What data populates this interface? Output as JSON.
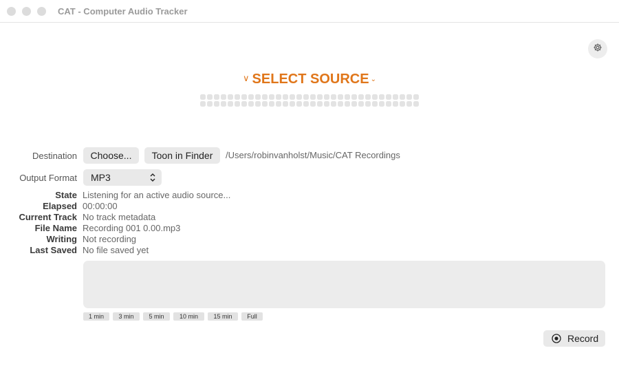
{
  "window": {
    "title": "CAT - Computer Audio Tracker"
  },
  "source": {
    "label": "SELECT SOURCE",
    "accent_color": "#e0761a"
  },
  "destination": {
    "label": "Destination",
    "choose_button": "Choose...",
    "finder_button": "Toon in Finder",
    "path": "/Users/robinvanholst/Music/CAT Recordings"
  },
  "output_format": {
    "label": "Output Format",
    "selected": "MP3"
  },
  "status": {
    "state_label": "State",
    "state_value": "Listening for an active audio source...",
    "elapsed_label": "Elapsed",
    "elapsed_value": "00:00:00",
    "track_label": "Current Track",
    "track_value": "No track metadata",
    "filename_label": "File Name",
    "filename_value": "Recording 001 0.00.mp3",
    "writing_label": "Writing",
    "writing_value": "Not recording",
    "saved_label": "Last Saved",
    "saved_value": "No file saved yet"
  },
  "time_ranges": [
    "1 min",
    "3 min",
    "5 min",
    "10 min",
    "15 min",
    "Full"
  ],
  "record": {
    "label": "Record"
  },
  "icons": {
    "settings": "gear-icon",
    "record": "record-icon",
    "chevron": "chevron-down-icon",
    "updown": "up-down-chevron-icon"
  }
}
